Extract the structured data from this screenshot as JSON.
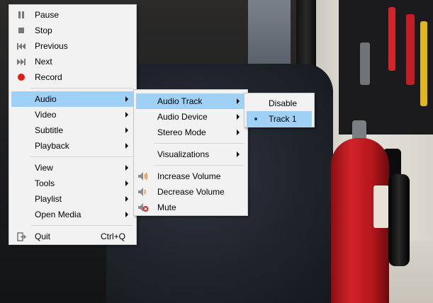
{
  "main_menu": {
    "items": [
      {
        "label": "Pause",
        "icon": "pause-icon"
      },
      {
        "label": "Stop",
        "icon": "stop-icon"
      },
      {
        "label": "Previous",
        "icon": "previous-icon"
      },
      {
        "label": "Next",
        "icon": "next-icon"
      },
      {
        "label": "Record",
        "icon": "record-icon"
      },
      {
        "label": "Audio",
        "submenu": true,
        "highlighted": true
      },
      {
        "label": "Video",
        "submenu": true
      },
      {
        "label": "Subtitle",
        "submenu": true
      },
      {
        "label": "Playback",
        "submenu": true
      },
      {
        "label": "View",
        "submenu": true
      },
      {
        "label": "Tools",
        "submenu": true
      },
      {
        "label": "Playlist",
        "submenu": true
      },
      {
        "label": "Open Media",
        "submenu": true
      },
      {
        "label": "Quit",
        "shortcut": "Ctrl+Q",
        "icon": "quit-icon"
      }
    ]
  },
  "audio_menu": {
    "items": [
      {
        "label": "Audio Track",
        "submenu": true,
        "highlighted": true
      },
      {
        "label": "Audio Device",
        "submenu": true
      },
      {
        "label": "Stereo Mode",
        "submenu": true
      },
      {
        "label": "Visualizations",
        "submenu": true
      },
      {
        "label": "Increase Volume",
        "icon": "volume-up-icon"
      },
      {
        "label": "Decrease Volume",
        "icon": "volume-down-icon"
      },
      {
        "label": "Mute",
        "icon": "mute-icon"
      }
    ]
  },
  "audio_track_menu": {
    "items": [
      {
        "label": "Disable"
      },
      {
        "label": "Track 1",
        "selected": true,
        "highlighted": true
      }
    ]
  },
  "colors": {
    "highlight": "#9fd0f5",
    "menu_bg": "#f2f2f2",
    "record_red": "#e31b12",
    "volume_orange": "#e8891e"
  }
}
